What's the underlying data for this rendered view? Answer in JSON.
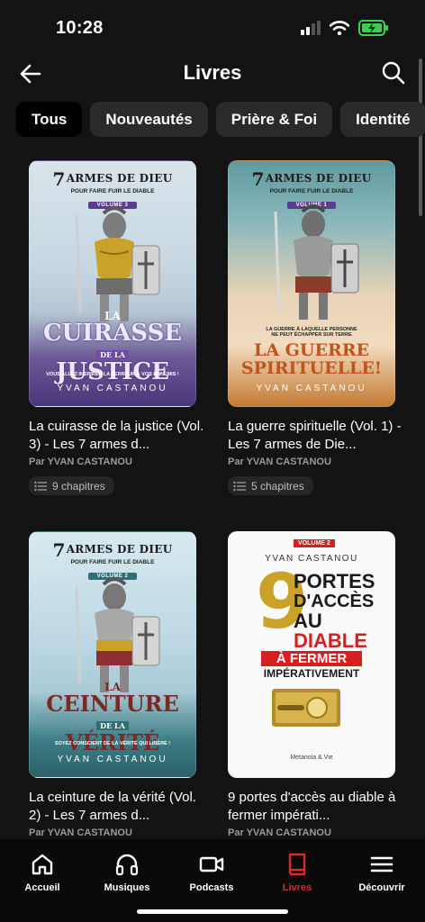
{
  "status": {
    "time": "10:28"
  },
  "header": {
    "title": "Livres",
    "back_icon": "arrow-left-icon",
    "search_icon": "search-icon"
  },
  "tabs": [
    {
      "label": "Tous",
      "active": true
    },
    {
      "label": "Nouveautés",
      "active": false
    },
    {
      "label": "Prière & Foi",
      "active": false
    },
    {
      "label": "Identité",
      "active": false
    }
  ],
  "books": [
    {
      "title": "La cuirasse de la justice (Vol. 3) - Les 7 armes d...",
      "author": "Par YVAN CASTANOU",
      "chapters": "9 chapitres",
      "cover": {
        "series_seven": "7",
        "series_title": "ARMES DE DIEU",
        "series_sub": "POUR FAIRE FUIR LE DIABLE",
        "volume": "VOLUME 3",
        "big_1": "LA",
        "big_2": "CUIRASSE",
        "big_3": "DE LA",
        "big_4": "JUSTICE",
        "tagline": "VOUS ALLEZ INSPIRER LA TERREUR À VOS ENNEMIS !",
        "author": "YVAN CASTANOU"
      }
    },
    {
      "title": "La guerre spirituelle (Vol. 1) - Les 7 armes de Die...",
      "author": "Par YVAN CASTANOU",
      "chapters": "5 chapitres",
      "cover": {
        "series_seven": "7",
        "series_title": "ARMES DE DIEU",
        "series_sub": "POUR FAIRE FUIR LE DIABLE",
        "volume": "VOLUME 1",
        "tagline_1": "LA GUERRE À LAQUELLE PERSONNE",
        "tagline_2": "NE PEUT ÉCHAPPER SUR TERRE",
        "big_1": "LA GUERRE",
        "big_2": "SPIRITUELLE!",
        "author": "YVAN CASTANOU"
      }
    },
    {
      "title": "La ceinture de la vérité (Vol. 2) - Les 7 armes d...",
      "author": "Par YVAN CASTANOU",
      "chapters": "",
      "cover": {
        "series_seven": "7",
        "series_title": "ARMES DE DIEU",
        "series_sub": "POUR FAIRE FUIR LE DIABLE",
        "volume": "VOLUME 2",
        "big_1": "LA",
        "big_2": "CEINTURE",
        "big_3": "DE LA",
        "big_4": "VÉRITÉ",
        "tagline": "SOYEZ CONSCIENT DE LA VÉRITÉ QUI LIBÈRE !",
        "author": "YVAN CASTANOU"
      }
    },
    {
      "title": "9 portes d'accès au diable à fermer impérati...",
      "author": "Par YVAN CASTANOU",
      "chapters": "",
      "cover": {
        "volume": "VOLUME 2",
        "author": "YVAN CASTANOU",
        "nine": "9",
        "line_1": "PORTES",
        "line_2": "D'ACCÈS",
        "line_3a": "AU ",
        "line_3b": "DIABLE",
        "line_4": "À FERMER",
        "line_5": "IMPÉRATIVEMENT",
        "publisher": "Metanoia & Vie"
      }
    }
  ],
  "nav": [
    {
      "label": "Accueil",
      "icon": "home-icon",
      "active": false
    },
    {
      "label": "Musiques",
      "icon": "headphones-icon",
      "active": false
    },
    {
      "label": "Podcasts",
      "icon": "video-camera-icon",
      "active": false
    },
    {
      "label": "Livres",
      "icon": "book-icon",
      "active": true
    },
    {
      "label": "Découvrir",
      "icon": "menu-icon",
      "active": false
    }
  ],
  "colors": {
    "background": "#131313",
    "accent": "#e32626",
    "tab_bg": "#2a2a2a"
  }
}
